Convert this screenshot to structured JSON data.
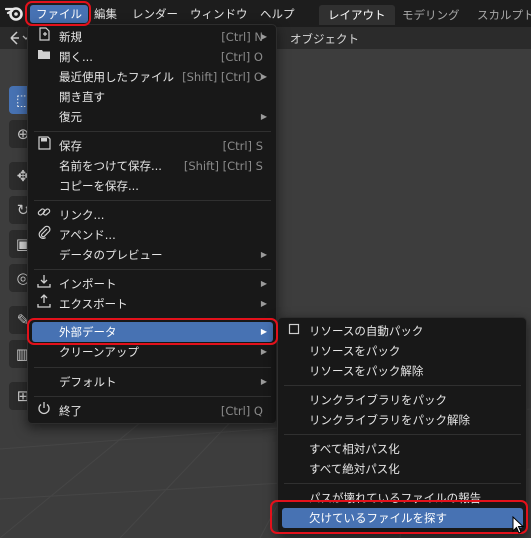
{
  "topbar": {
    "menus": [
      "ファイル",
      "編集",
      "レンダー",
      "ウィンドウ",
      "ヘルプ"
    ],
    "workspaces": [
      "レイアウト",
      "モデリング",
      "スカルプト"
    ]
  },
  "viewport": {
    "object_menu": "オブジェクト"
  },
  "file_menu": {
    "items": [
      {
        "label": "新規",
        "shortcut": "[Ctrl] N",
        "icon": "new-file-icon"
      },
      {
        "label": "開く...",
        "shortcut": "[Ctrl] O",
        "icon": "folder-icon"
      },
      {
        "label": "最近使用したファイル",
        "shortcut": "[Shift] [Ctrl] O",
        "icon": ""
      },
      {
        "label": "開き直す",
        "shortcut": "",
        "icon": ""
      },
      {
        "label": "復元",
        "shortcut": "",
        "icon": ""
      },
      {
        "label": "保存",
        "shortcut": "[Ctrl] S",
        "icon": "save-icon"
      },
      {
        "label": "名前をつけて保存...",
        "shortcut": "[Shift] [Ctrl] S",
        "icon": ""
      },
      {
        "label": "コピーを保存...",
        "shortcut": "",
        "icon": ""
      },
      {
        "label": "リンク...",
        "shortcut": "",
        "icon": "link-icon"
      },
      {
        "label": "アペンド...",
        "shortcut": "",
        "icon": "paperclip-icon"
      },
      {
        "label": "データのプレビュー",
        "shortcut": "",
        "icon": ""
      },
      {
        "label": "インポート",
        "shortcut": "",
        "icon": "import-icon"
      },
      {
        "label": "エクスポート",
        "shortcut": "",
        "icon": "export-icon"
      },
      {
        "label": "外部データ",
        "shortcut": "",
        "icon": ""
      },
      {
        "label": "クリーンアップ",
        "shortcut": "",
        "icon": ""
      },
      {
        "label": "デフォルト",
        "shortcut": "",
        "icon": ""
      },
      {
        "label": "終了",
        "shortcut": "[Ctrl] Q",
        "icon": "power-icon"
      }
    ]
  },
  "external_data_menu": {
    "items": [
      {
        "label": "リソースの自動パック",
        "icon": "checkbox-icon"
      },
      {
        "label": "リソースをパック",
        "icon": ""
      },
      {
        "label": "リソースをパック解除",
        "icon": ""
      },
      {
        "label": "リンクライブラリをパック",
        "icon": ""
      },
      {
        "label": "リンクライブラリをパック解除",
        "icon": ""
      },
      {
        "label": "すべて相対パス化",
        "icon": ""
      },
      {
        "label": "すべて絶対パス化",
        "icon": ""
      },
      {
        "label": "パスが壊れているファイルの報告",
        "icon": ""
      },
      {
        "label": "欠けているファイルを探す",
        "icon": ""
      }
    ]
  },
  "colors": {
    "accent": "#4772b3",
    "callout": "#e3111b",
    "menu_bg": "#181818"
  }
}
